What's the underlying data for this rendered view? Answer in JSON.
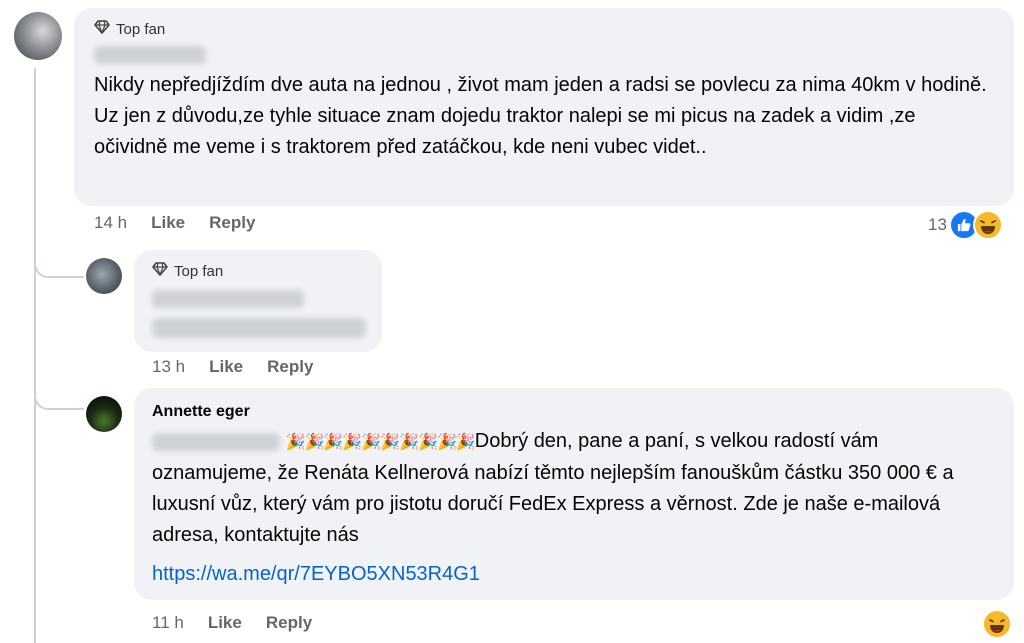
{
  "comment1": {
    "badge": "Top fan",
    "text": "Nikdy nepředjíždím dve auta na jednou , život mam jeden a radsi se povlecu za nima 40km v hodině. Uz jen z důvodu,ze tyhle situace znam dojedu traktor nalepi se mi picus na zadek a vidim ,ze očividně me veme i s traktorem před zatáčkou, kde neni vubec videt..",
    "time": "14 h",
    "like": "Like",
    "reply": "Reply",
    "reaction_count": "13",
    "reaction_icons": [
      "like-icon",
      "haha-icon"
    ]
  },
  "comment2": {
    "badge": "Top fan",
    "time": "13 h",
    "like": "Like",
    "reply": "Reply"
  },
  "comment3": {
    "author": "Annette eger",
    "text": "Dobrý den, pane a paní, s velkou radostí vám oznamujeme, že Renáta Kellnerová nabízí těmto nejlepším fanouškům částku 350 000 € a luxusní vůz, který vám pro jistotu doručí FedEx Express a věrnost. Zde je naše e-mailová adresa, kontaktujte nás",
    "party_emoji": "🎉🎉🎉🎉🎉🎉🎉🎉🎉🎉",
    "link": "https://wa.me/qr/7EYBO5XN53R4G1",
    "time": "11 h",
    "like": "Like",
    "reply": "Reply",
    "reaction_icons": [
      "haha-icon"
    ]
  },
  "colors": {
    "bubble": "#f0f2f5",
    "link": "#0064d1",
    "meta": "#65676b",
    "like_blue": "#1877f2"
  }
}
